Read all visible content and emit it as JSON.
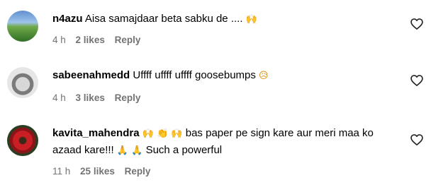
{
  "comments": [
    {
      "username": "n4azu",
      "text": "Aisa samajdaar beta sabku de ....",
      "emoji": "🙌",
      "time": "4 h",
      "likes": "2 likes",
      "reply": "Reply"
    },
    {
      "username": "sabeenahmedd",
      "text": "Uffff uffff uffff goosebumps",
      "emoji": "😥",
      "time": "4 h",
      "likes": "3 likes",
      "reply": "Reply"
    },
    {
      "username": "kavita_mahendra",
      "emoji_a": "🙌 👏 🙌",
      "text_a": "bas paper pe sign kare aur meri maa ko azaad kare!!!",
      "emoji_b": "🙏 🙏",
      "text_b": "Such a powerful",
      "time": "11 h",
      "likes": "25 likes",
      "reply": "Reply"
    }
  ],
  "icons": {
    "like": "heart-outline-icon",
    "avatar": "profile-avatar"
  }
}
